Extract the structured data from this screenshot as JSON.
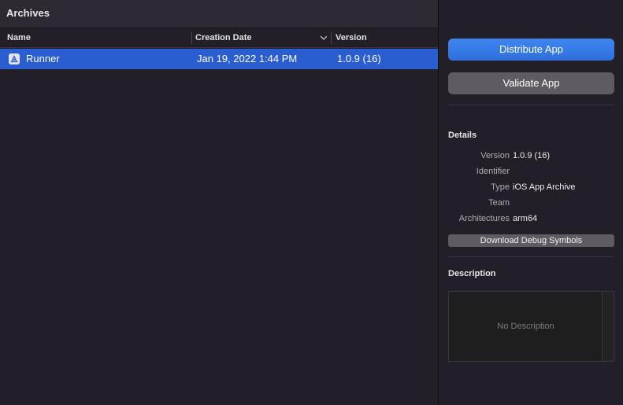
{
  "archives": {
    "title": "Archives",
    "columns": {
      "name": "Name",
      "creation_date": "Creation Date",
      "version": "Version"
    },
    "rows": [
      {
        "icon": "app-store-icon",
        "name": "Runner",
        "creation_date": "Jan 19, 2022 1:44 PM",
        "version": "1.0.9 (16)",
        "selected": true
      }
    ]
  },
  "inspector": {
    "distribute_label": "Distribute App",
    "validate_label": "Validate App",
    "details_title": "Details",
    "details": {
      "version_label": "Version",
      "version_value": "1.0.9 (16)",
      "identifier_label": "Identifier",
      "identifier_value": "",
      "type_label": "Type",
      "type_value": "iOS App Archive",
      "team_label": "Team",
      "team_value": "",
      "architectures_label": "Architectures",
      "architectures_value": "arm64"
    },
    "download_symbols_label": "Download Debug Symbols",
    "description_title": "Description",
    "description_placeholder": "No Description"
  },
  "colors": {
    "selection": "#2a5ed0",
    "primary_button": "#2f6fdc",
    "secondary_button": "#5e5b62",
    "background": "#231f29"
  }
}
